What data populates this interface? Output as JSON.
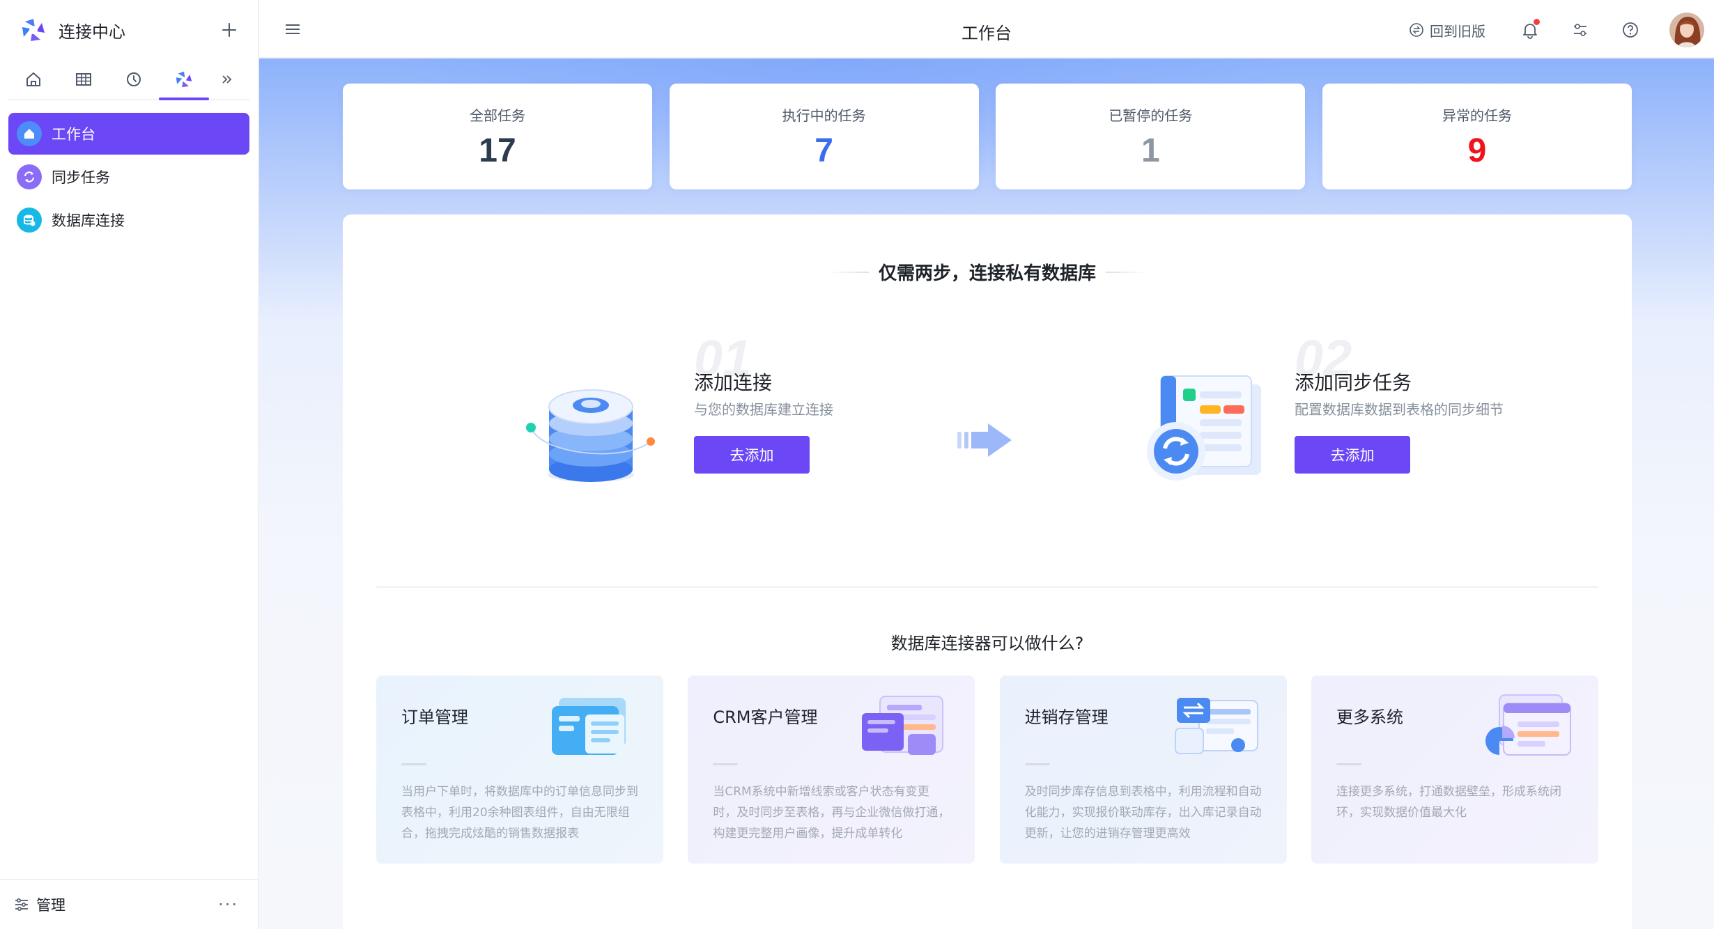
{
  "sidebar": {
    "title": "连接中心",
    "nav": [
      {
        "label": "工作台"
      },
      {
        "label": "同步任务"
      },
      {
        "label": "数据库连接"
      }
    ],
    "footer_label": "管理",
    "more": "···"
  },
  "topbar": {
    "title": "工作台",
    "back_old": "回到旧版"
  },
  "stats": [
    {
      "label": "全部任务",
      "value": "17",
      "color": "#2d3b4f"
    },
    {
      "label": "执行中的任务",
      "value": "7",
      "color": "#3a6df0"
    },
    {
      "label": "已暂停的任务",
      "value": "1",
      "color": "#8e96a3"
    },
    {
      "label": "异常的任务",
      "value": "9",
      "color": "#f2121a"
    }
  ],
  "guide": {
    "title": "仅需两步，连接私有数据库",
    "steps": [
      {
        "num": "01",
        "title": "添加连接",
        "desc": "与您的数据库建立连接",
        "button": "去添加"
      },
      {
        "num": "02",
        "title": "添加同步任务",
        "desc": "配置数据库数据到表格的同步细节",
        "button": "去添加"
      }
    ]
  },
  "features": {
    "title": "数据库连接器可以做什么?",
    "items": [
      {
        "title": "订单管理",
        "desc": "当用户下单时，将数据库中的订单信息同步到表格中，利用20余种图表组件，自由无限组合，拖拽完成炫酷的销售数据报表"
      },
      {
        "title": "CRM客户管理",
        "desc": "当CRM系统中新增线索或客户状态有变更时，及时同步至表格，再与企业微信做打通，构建更完整用户画像，提升成单转化"
      },
      {
        "title": "进销存管理",
        "desc": "及时同步库存信息到表格中，利用流程和自动化能力，实现报价联动库存，出入库记录自动更新，让您的进销存管理更高效"
      },
      {
        "title": "更多系统",
        "desc": "连接更多系统，打通数据壁垒，形成系统闭环，实现数据价值最大化"
      }
    ]
  },
  "colors": {
    "accent": "#6b47f5"
  }
}
